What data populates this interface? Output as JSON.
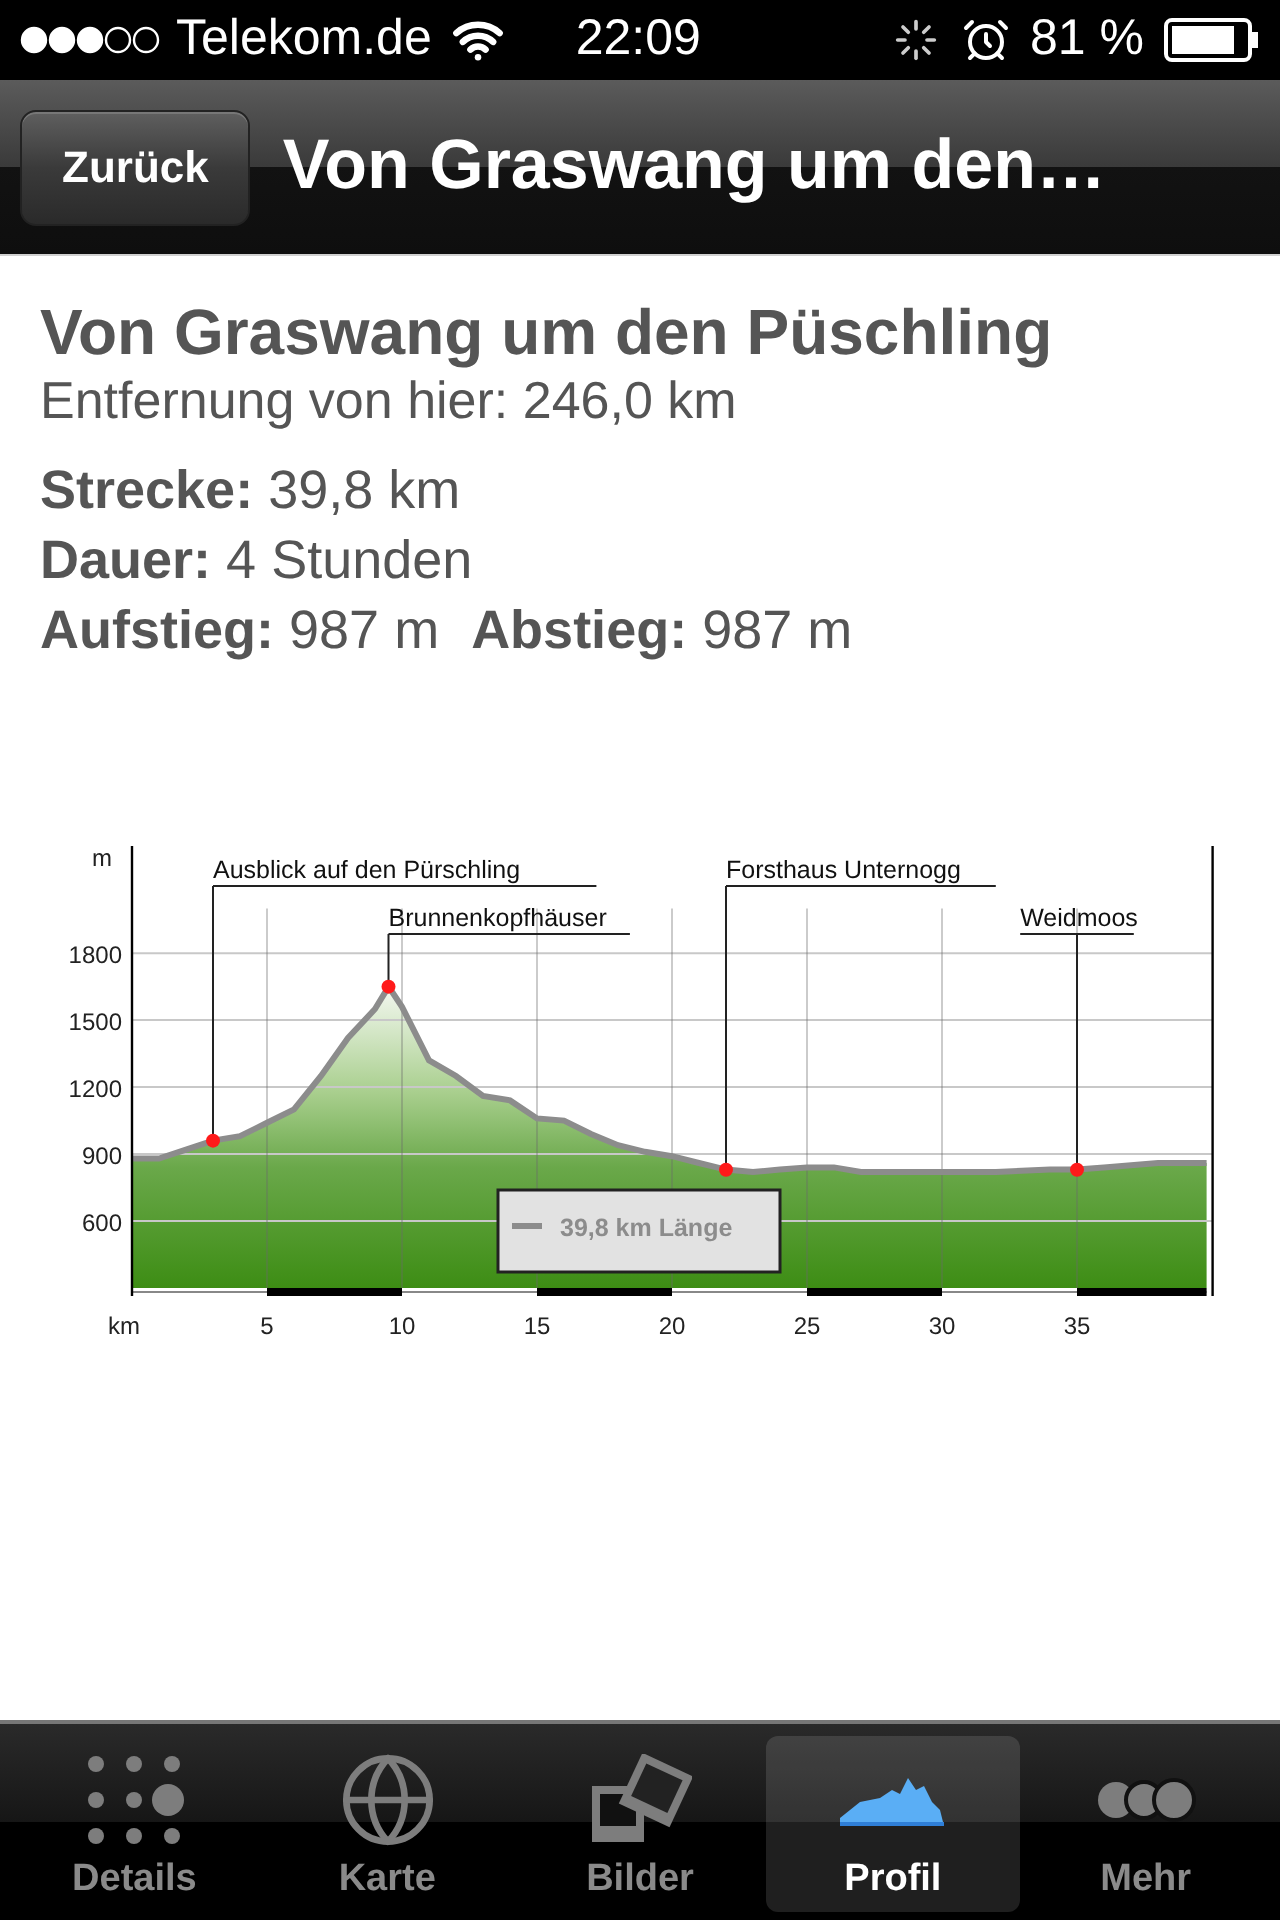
{
  "status_bar": {
    "carrier": "Telekom.de",
    "time": "22:09",
    "battery": "81 %"
  },
  "nav_bar": {
    "back_button": "Zurück",
    "title": "Von Graswang um den…"
  },
  "tour": {
    "title": "Von Graswang um den Püschling",
    "distance": "Entfernung von hier: 246,0 km",
    "stats": [
      [
        {
          "label": "Strecke:",
          "value": "39,8 km"
        }
      ],
      [
        {
          "label": "Dauer:",
          "value": "4 Stunden"
        }
      ],
      [
        {
          "label": "Aufstieg:",
          "value": "987 m"
        },
        {
          "label": "Abstieg:",
          "value": "987 m"
        }
      ]
    ]
  },
  "profile": {
    "chart_data": {
      "type": "area",
      "xlabel": "km",
      "ylabel": "m",
      "grid": true,
      "x": [
        0,
        1,
        2,
        3,
        4,
        5,
        6,
        7,
        8,
        9,
        9.5,
        10,
        11,
        12,
        13,
        14,
        15,
        16,
        17,
        18,
        19,
        20,
        21,
        22,
        23,
        24,
        25,
        26,
        27,
        28,
        30,
        32,
        34,
        35,
        36,
        38,
        39.8
      ],
      "series": [
        {
          "name": "39,8 km Länge",
          "color": "#8c8c8c",
          "values": [
            880,
            880,
            920,
            960,
            980,
            1040,
            1100,
            1250,
            1420,
            1550,
            1650,
            1560,
            1320,
            1250,
            1160,
            1140,
            1060,
            1050,
            990,
            940,
            910,
            890,
            860,
            830,
            820,
            830,
            840,
            840,
            820,
            820,
            820,
            820,
            830,
            830,
            840,
            860,
            860
          ]
        }
      ],
      "xlim": [
        0,
        39.8
      ],
      "ylim": [
        300,
        2280
      ],
      "xticks": [
        5,
        10,
        15,
        20,
        25,
        30,
        35
      ],
      "yticks": [
        600,
        900,
        1200,
        1500,
        1800
      ],
      "annotations": [
        {
          "x": 3,
          "y": 960,
          "text": "Ausblick auf den Pürschling"
        },
        {
          "x": 9.5,
          "y": 1650,
          "text": "Brunnenkopfhäuser"
        },
        {
          "x": 22,
          "y": 830,
          "text": "Forsthaus Unternogg"
        },
        {
          "x": 35,
          "y": 830,
          "text": "Weidmoos"
        }
      ]
    }
  },
  "tab_bar": {
    "items": [
      {
        "kind": "details",
        "label": "Details",
        "selected": false
      },
      {
        "kind": "map",
        "label": "Karte",
        "selected": false
      },
      {
        "kind": "pictures",
        "label": "Bilder",
        "selected": false
      },
      {
        "kind": "profile",
        "label": "Profil",
        "selected": true
      },
      {
        "kind": "more",
        "label": "Mehr",
        "selected": false
      }
    ]
  }
}
